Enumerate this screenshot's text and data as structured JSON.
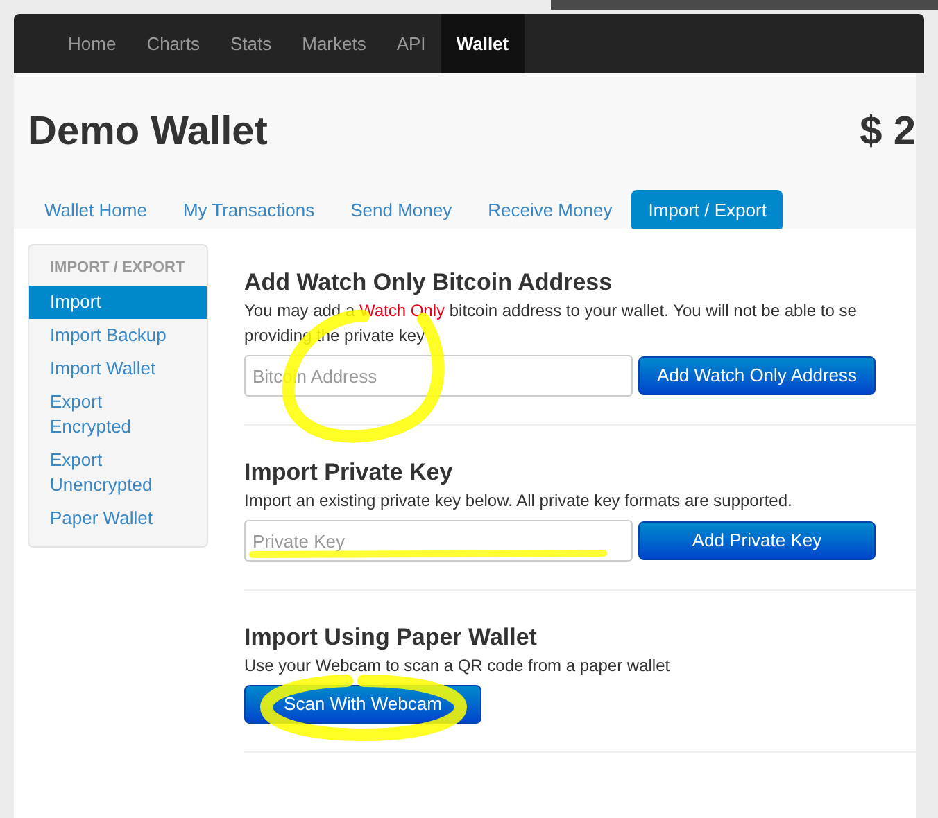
{
  "navbar": {
    "items": [
      {
        "label": "Home",
        "selected": false
      },
      {
        "label": "Charts",
        "selected": false
      },
      {
        "label": "Stats",
        "selected": false
      },
      {
        "label": "Markets",
        "selected": false
      },
      {
        "label": "API",
        "selected": false
      },
      {
        "label": "Wallet",
        "selected": true
      }
    ]
  },
  "header": {
    "title": "Demo Wallet",
    "balance": "$ 2"
  },
  "tabs": [
    {
      "label": "Wallet Home",
      "selected": false
    },
    {
      "label": "My Transactions",
      "selected": false
    },
    {
      "label": "Send Money",
      "selected": false
    },
    {
      "label": "Receive Money",
      "selected": false
    },
    {
      "label": "Import / Export",
      "selected": true
    }
  ],
  "sidebar": {
    "heading": "IMPORT / EXPORT",
    "items": [
      {
        "label": "Import",
        "selected": true
      },
      {
        "label": "Import Backup",
        "selected": false
      },
      {
        "label": "Import Wallet",
        "selected": false
      },
      {
        "label": "Export Encrypted",
        "selected": false
      },
      {
        "label": "Export Unencrypted",
        "selected": false
      },
      {
        "label": "Paper Wallet",
        "selected": false
      }
    ]
  },
  "sections": [
    {
      "kind": "field",
      "title": "Add Watch Only Bitcoin Address",
      "description": [
        {
          "text": "You may add a ",
          "emphasis": false
        },
        {
          "text": "Watch Only",
          "emphasis": true
        },
        {
          "text": " bitcoin address to your wallet. You will not be able to se",
          "emphasis": false
        }
      ],
      "description_line_2": "providing the private key",
      "placeholder": "Bitcoin Address",
      "button": "Add Watch Only Address"
    },
    {
      "kind": "field",
      "title": "Import Private Key",
      "description": [
        {
          "text": "Import an existing private key below. All private key formats are supported.",
          "emphasis": false
        }
      ],
      "placeholder": "Private Key",
      "button": "Add Private Key"
    },
    {
      "kind": "button",
      "title": "Import Using Paper Wallet",
      "description": [
        {
          "text": "Use your Webcam to scan a QR code from a paper wallet",
          "emphasis": false
        }
      ],
      "button": "Scan With Webcam"
    }
  ]
}
